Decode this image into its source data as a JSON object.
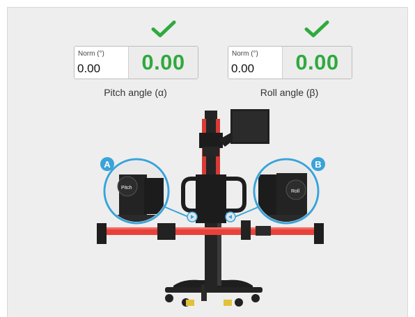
{
  "pitch": {
    "norm_label": "Norm (°)",
    "norm_value": "0.00",
    "measured_value": "0.00",
    "caption": "Pitch angle (α)",
    "status": "ok"
  },
  "roll": {
    "norm_label": "Norm (°)",
    "norm_value": "0.00",
    "measured_value": "0.00",
    "caption": "Roll angle (β)",
    "status": "ok"
  },
  "callouts": {
    "left_marker": "A",
    "right_marker": "B",
    "left_lens_text": "Pitch",
    "right_lens_text": "Roll"
  },
  "colors": {
    "ok_green": "#2faa3e",
    "marker_blue": "#3aa3d9",
    "bar_red": "#e8413a",
    "frame_black": "#1e1e1e"
  }
}
